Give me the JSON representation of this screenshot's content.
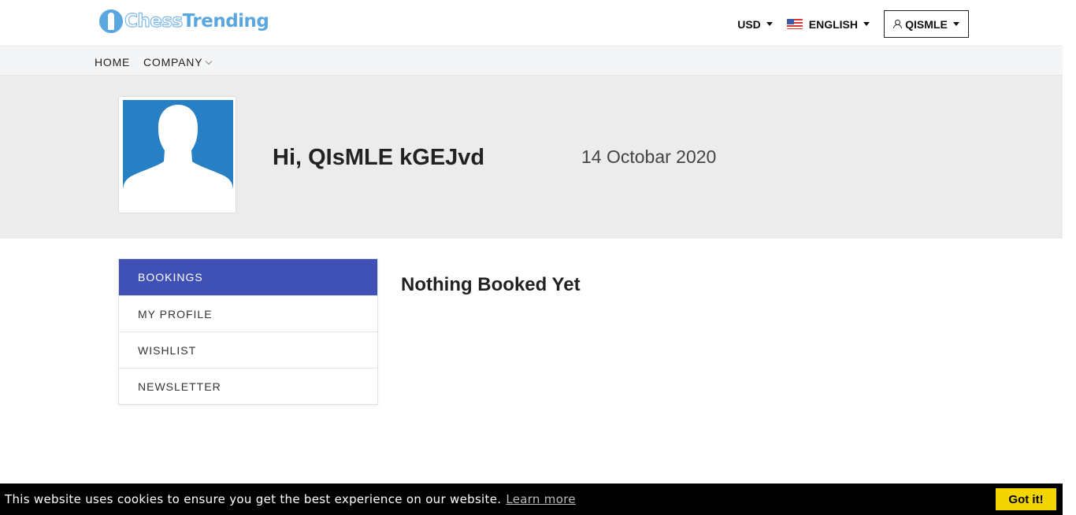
{
  "header": {
    "logo_text_1": "Chess",
    "logo_text_2": "Trending",
    "currency_label": "USD",
    "language_label": "ENGLISH",
    "user_label": "QISMLE"
  },
  "nav": {
    "items": [
      {
        "label": "HOME"
      },
      {
        "label": "COMPANY"
      }
    ]
  },
  "profile": {
    "greeting": "Hi, QIsMLE kGEJvd",
    "date": "14 Octobar 2020"
  },
  "sidebar": {
    "items": [
      {
        "label": "BOOKINGS",
        "active": true
      },
      {
        "label": "MY PROFILE",
        "active": false
      },
      {
        "label": "WISHLIST",
        "active": false
      },
      {
        "label": "NEWSLETTER",
        "active": false
      }
    ]
  },
  "main": {
    "empty_message": "Nothing Booked Yet"
  },
  "cookie": {
    "message": "This website uses cookies to ensure you get the best experience on our website.",
    "link_label": "Learn more",
    "button_label": "Got it!"
  },
  "colors": {
    "accent": "#3f51b5",
    "logo_blue": "#5aa6df",
    "cookie_button": "#f1d600"
  }
}
